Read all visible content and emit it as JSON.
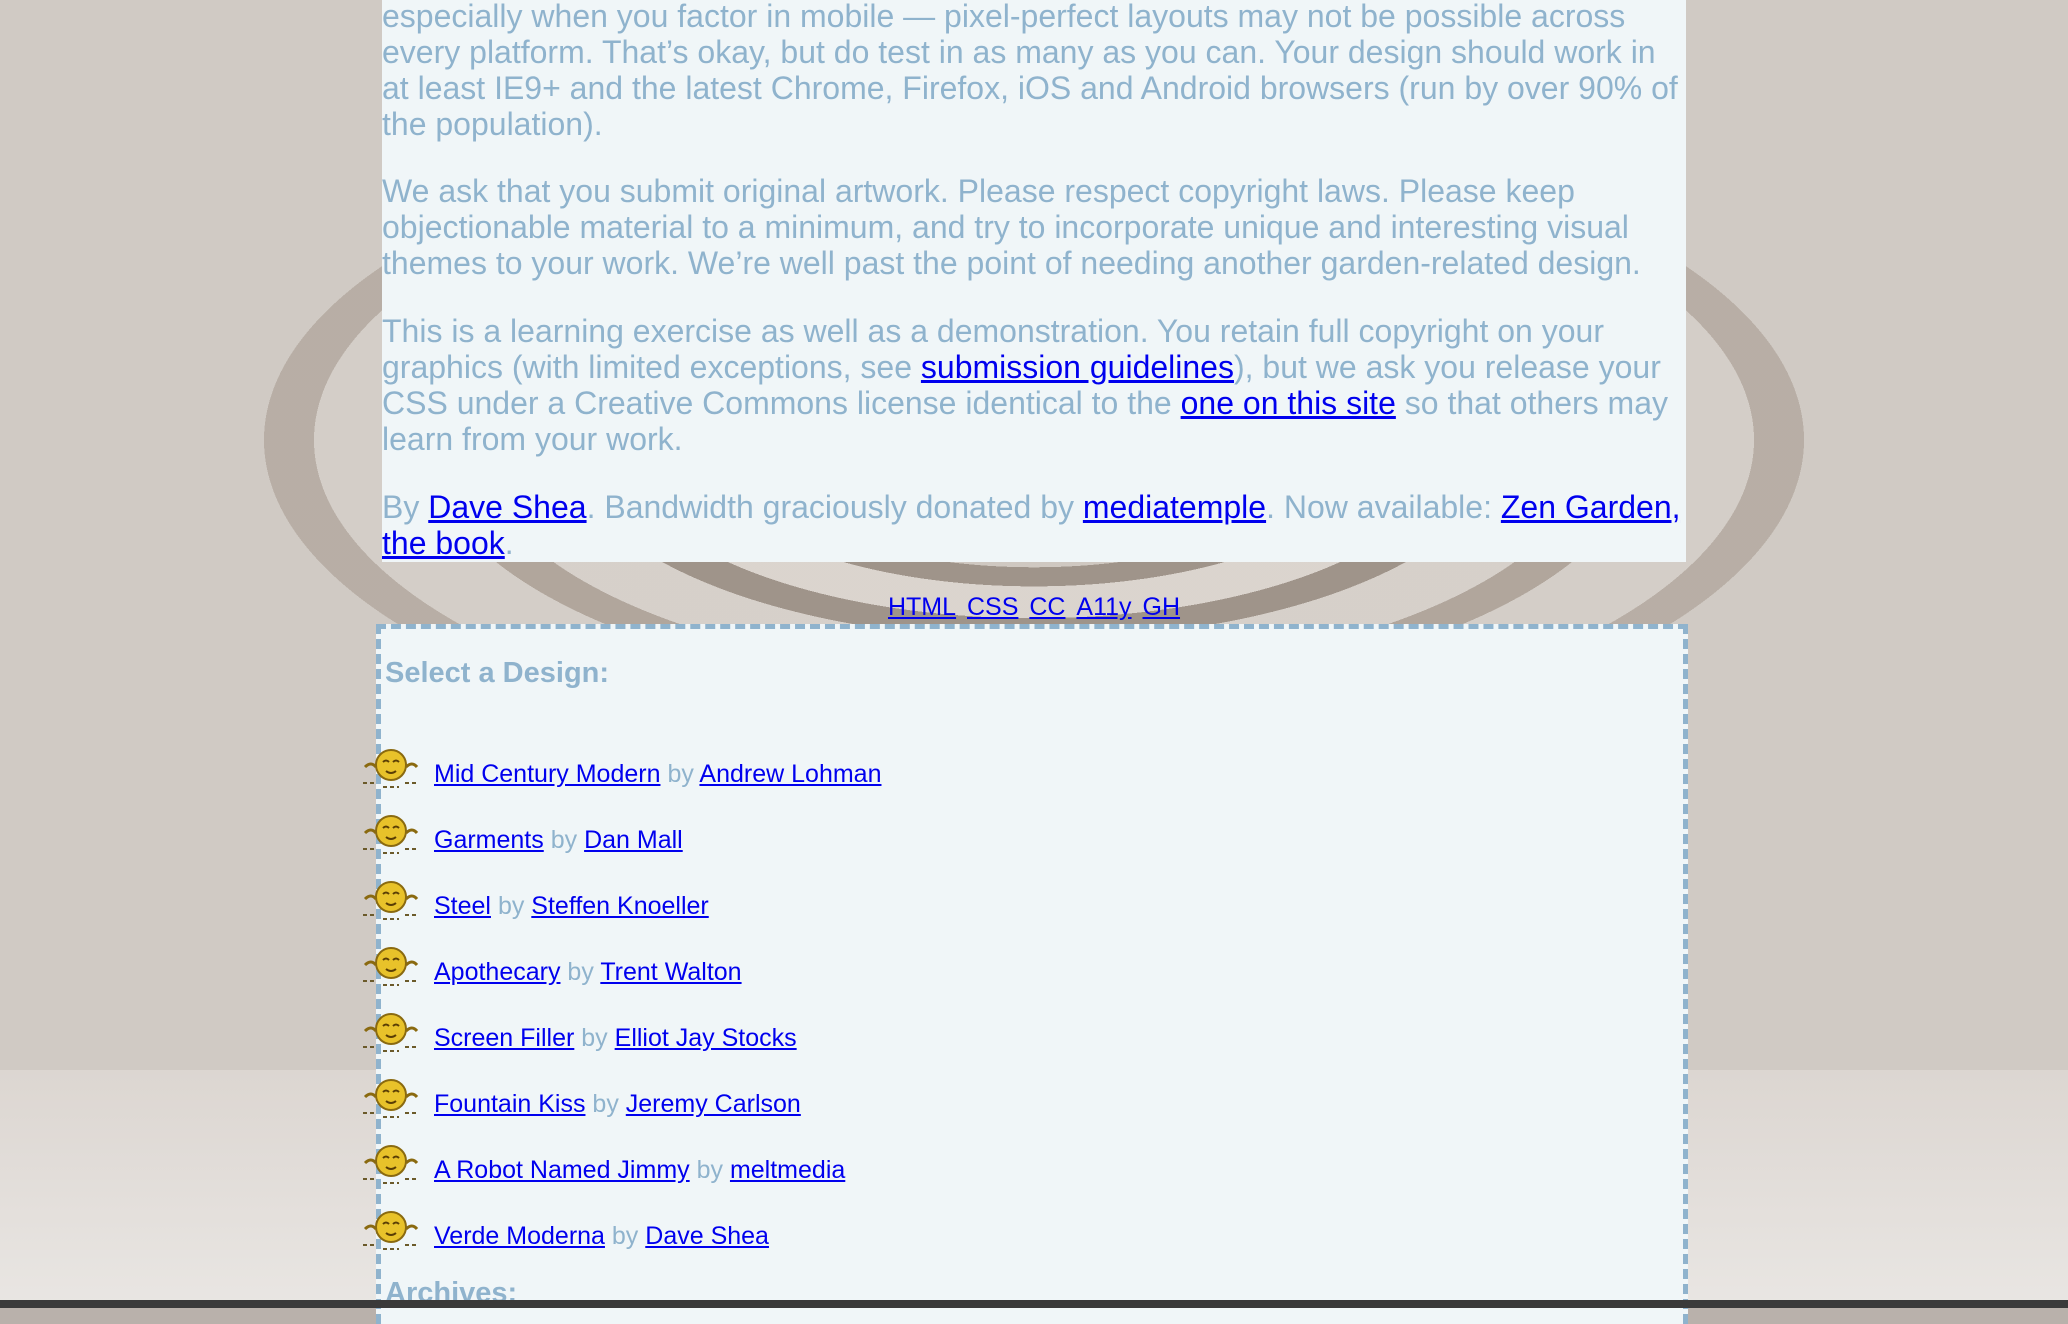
{
  "intro": {
    "p1": "especially when you factor in mobile — pixel-perfect layouts may not be possible across every platform. That’s okay, but do test in as many as you can. Your design should work in at least IE9+ and the latest Chrome, Firefox, iOS and Android browsers (run by over 90% of the population).",
    "p2": "We ask that you submit original artwork. Please respect copyright laws. Please keep objectionable material to a minimum, and try to incorporate unique and interesting visual themes to your work. We’re well past the point of needing another garden-related design.",
    "p3_before": "This is a learning exercise as well as a demonstration. You retain full copyright on your graphics (with limited exceptions, see ",
    "p3_link1": "submission guidelines",
    "p3_middle": "), but we ask you release your CSS under a Creative Commons license identical to the ",
    "p3_link2": "one on this site",
    "p3_after": " so that others may learn from your work.",
    "p4_by": "By ",
    "p4_author": "Dave Shea",
    "p4_bandwidth": ". Bandwidth graciously donated by ",
    "p4_host": "mediatemple",
    "p4_now": ". Now available: ",
    "p4_book": "Zen Garden, the book",
    "p4_end": "."
  },
  "footer_links": [
    "HTML",
    "CSS",
    "CC",
    "A11y",
    "GH"
  ],
  "design_select": {
    "heading": "Select a Design:",
    "by_word": "by",
    "items": [
      {
        "design": "Mid Century Modern",
        "author": "Andrew Lohman"
      },
      {
        "design": "Garments",
        "author": "Dan Mall"
      },
      {
        "design": "Steel",
        "author": "Steffen Knoeller"
      },
      {
        "design": "Apothecary",
        "author": "Trent Walton"
      },
      {
        "design": "Screen Filler",
        "author": "Elliot Jay Stocks"
      },
      {
        "design": "Fountain Kiss",
        "author": "Jeremy Carlson"
      },
      {
        "design": "A Robot Named Jimmy",
        "author": "meltmedia"
      },
      {
        "design": "Verde Moderna",
        "author": "Dave Shea"
      }
    ],
    "bullet_icon": "smiling-sun-icon"
  },
  "archives": {
    "heading": "Archives:"
  },
  "colors": {
    "text": "#8fb3cd",
    "link": "#0000ee",
    "panel": "#f0f6f8",
    "border": "#8fb3cd"
  }
}
